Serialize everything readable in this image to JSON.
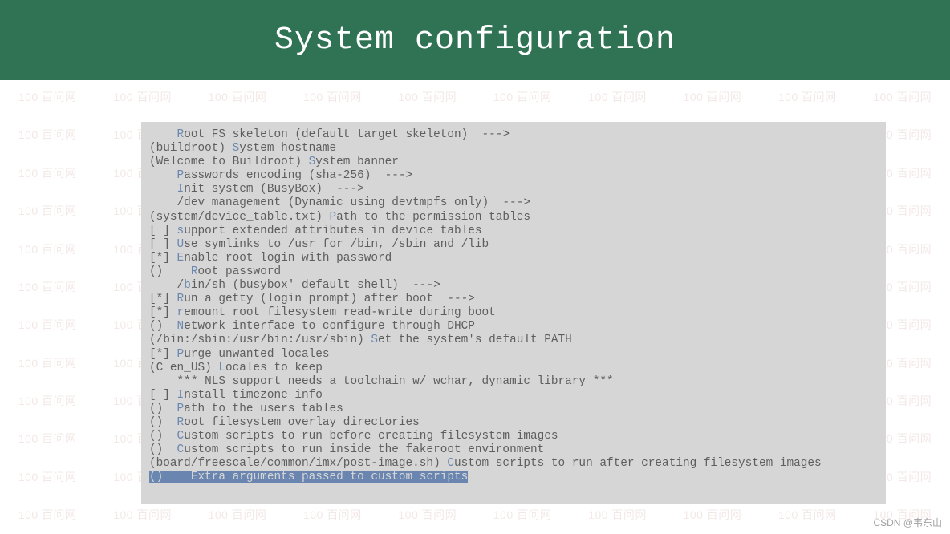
{
  "header": {
    "title": "System configuration"
  },
  "watermark": "100 百问网",
  "attribution": "CSDN @韦东山",
  "menu": {
    "lines": [
      {
        "indent": "    ",
        "hl": "R",
        "text": "oot FS skeleton (default target skeleton)  --->"
      },
      {
        "indent": "(buildroot) ",
        "hl": "S",
        "text": "ystem hostname"
      },
      {
        "indent": "(Welcome to Buildroot) ",
        "hl": "S",
        "text": "ystem banner"
      },
      {
        "indent": "    ",
        "hl": "P",
        "text": "asswords encoding (sha-256)  --->"
      },
      {
        "indent": "    ",
        "hl": "I",
        "text": "nit system (BusyBox)  --->"
      },
      {
        "indent": "    /dev management (Dynamic using devtmpfs only)  --->",
        "hl": "",
        "text": ""
      },
      {
        "indent": "(system/device_table.txt) ",
        "hl": "P",
        "text": "ath to the permission tables"
      },
      {
        "indent": "[ ] ",
        "hl": "s",
        "text": "upport extended attributes in device tables"
      },
      {
        "indent": "[ ] ",
        "hl": "U",
        "text": "se symlinks to /usr for /bin, /sbin and /lib"
      },
      {
        "indent": "[*] ",
        "hl": "E",
        "text": "nable root login with password"
      },
      {
        "indent": "()    ",
        "hl": "R",
        "text": "oot password"
      },
      {
        "indent": "    /",
        "hl": "b",
        "text": "in/sh (busybox' default shell)  --->"
      },
      {
        "indent": "[*] ",
        "hl": "R",
        "text": "un a getty (login prompt) after boot  --->"
      },
      {
        "indent": "[*] ",
        "hl": "r",
        "text": "emount root filesystem read-write during boot"
      },
      {
        "indent": "()  ",
        "hl": "N",
        "text": "etwork interface to configure through DHCP"
      },
      {
        "indent": "(/bin:/sbin:/usr/bin:/usr/sbin) ",
        "hl": "S",
        "text": "et the system's default PATH"
      },
      {
        "indent": "[*] ",
        "hl": "P",
        "text": "urge unwanted locales"
      },
      {
        "indent": "(C en_US) ",
        "hl": "L",
        "text": "ocales to keep"
      },
      {
        "indent": "    *** NLS support needs a toolchain w/ wchar, dynamic library ***",
        "hl": "",
        "text": ""
      },
      {
        "indent": "[ ] ",
        "hl": "I",
        "text": "nstall timezone info"
      },
      {
        "indent": "()  ",
        "hl": "P",
        "text": "ath to the users tables"
      },
      {
        "indent": "()  ",
        "hl": "R",
        "text": "oot filesystem overlay directories"
      },
      {
        "indent": "()  ",
        "hl": "C",
        "text": "ustom scripts to run before creating filesystem images"
      },
      {
        "indent": "()  ",
        "hl": "C",
        "text": "ustom scripts to run inside the fakeroot environment"
      },
      {
        "indent": "(board/freescale/common/imx/post-image.sh) ",
        "hl": "C",
        "text": "ustom scripts to run after creating filesystem images"
      }
    ],
    "selected": {
      "paren": "()",
      "gap": "    ",
      "hl": "E",
      "text": "xtra arguments passed to custom scripts"
    }
  }
}
